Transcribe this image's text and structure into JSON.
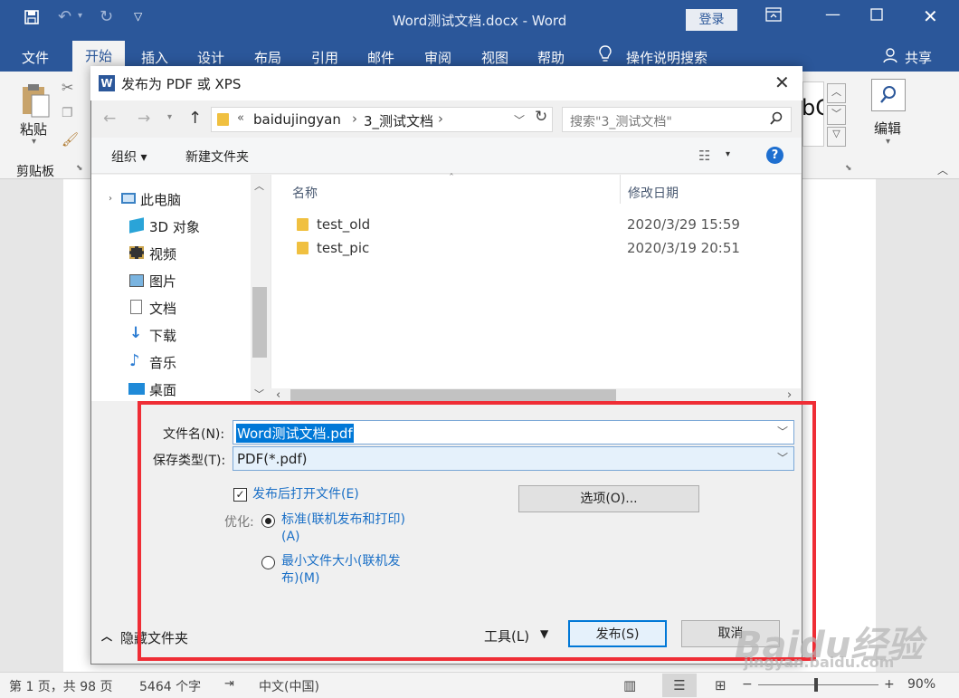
{
  "word": {
    "doc_title": "Word测试文档.docx  -  Word",
    "login": "登录",
    "tabs": [
      "文件",
      "开始",
      "插入",
      "设计",
      "布局",
      "引用",
      "邮件",
      "审阅",
      "视图",
      "帮助",
      "操作说明搜索",
      "共享"
    ],
    "paste_label": "粘贴",
    "clipboard_label": "剪贴板",
    "edit_label": "编辑",
    "style_fragment": "bC"
  },
  "dialog": {
    "title": "发布为 PDF 或 XPS",
    "breadcrumb": [
      "«",
      "baidujingyan",
      "›",
      "3_测试文档",
      "›"
    ],
    "search_placeholder": "搜索\"3_测试文档\"",
    "organize": "组织 ▾",
    "new_folder": "新建文件夹",
    "help": "?",
    "nav_items": [
      "此电脑",
      "3D 对象",
      "视频",
      "图片",
      "文档",
      "下载",
      "音乐",
      "桌面"
    ],
    "columns": [
      "名称",
      "修改日期"
    ],
    "files": [
      {
        "name": "test_old",
        "date": "2020/3/29 15:59"
      },
      {
        "name": "test_pic",
        "date": "2020/3/19 20:51"
      }
    ],
    "filename_label": "文件名(N):",
    "filename_value": "Word测试文档.pdf",
    "type_label": "保存类型(T):",
    "type_value": "PDF(*.pdf)",
    "open_after_label": "发布后打开文件(E)",
    "optimize_label": "优化:",
    "opt_standard_l1": "标准(联机发布和打印)",
    "opt_standard_l2": "(A)",
    "opt_min_l1": "最小文件大小(联机发",
    "opt_min_l2": "布)(M)",
    "options_btn": "选项(O)...",
    "hide_folders": "隐藏文件夹",
    "tools": "工具(L)",
    "publish_btn": "发布(S)",
    "cancel_btn": "取消"
  },
  "status": {
    "page": "第 1 页，共 98 页",
    "words": "5464 个字",
    "lang": "中文(中国)",
    "zoom": "90%"
  },
  "watermark": {
    "logo": "Baidu经验",
    "url": "jingyan.baidu.com"
  },
  "colors": {
    "word_blue": "#2b579a",
    "highlight_red": "#ef2d35",
    "link_blue": "#1a6fc6"
  }
}
